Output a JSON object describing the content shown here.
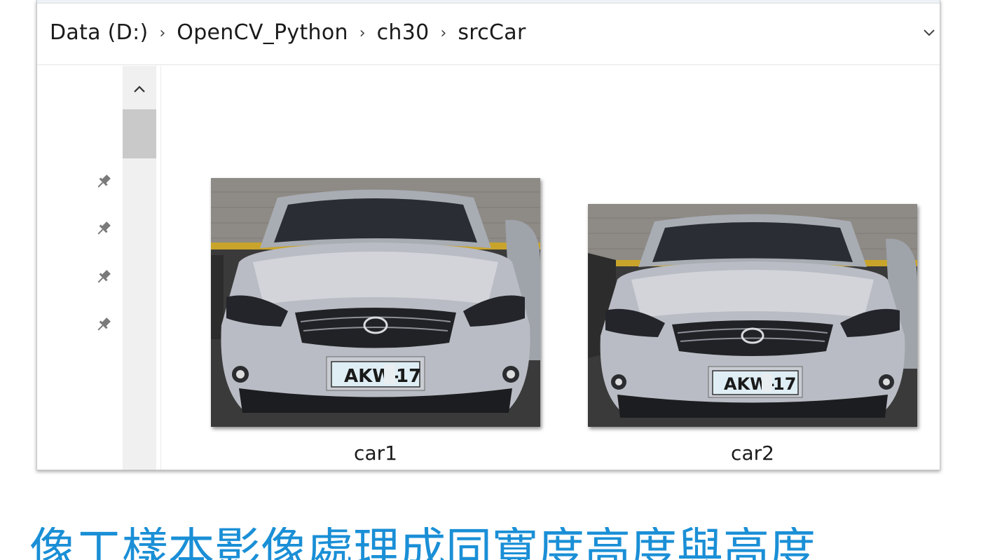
{
  "breadcrumb": {
    "items": [
      "Data (D:)",
      "OpenCV_Python",
      "ch30",
      "srcCar"
    ],
    "separator": "›"
  },
  "icons": {
    "history_dropdown": "chevron-down-icon",
    "pin": "pin-icon",
    "scroll_up": "chevron-up-icon"
  },
  "files": [
    {
      "name": "car1",
      "plate_text": "AKW-",
      "plate_suffix": "17"
    },
    {
      "name": "car2",
      "plate_text": "AKW-",
      "plate_suffix": "17"
    }
  ],
  "caption": "像工樣本影像處理成同寬度高度與高度",
  "colors": {
    "caption": "#1a8fd6",
    "car_body": "#b9bcc4",
    "garage_wall": "#8e8b86",
    "plate": "#dfeef4"
  }
}
